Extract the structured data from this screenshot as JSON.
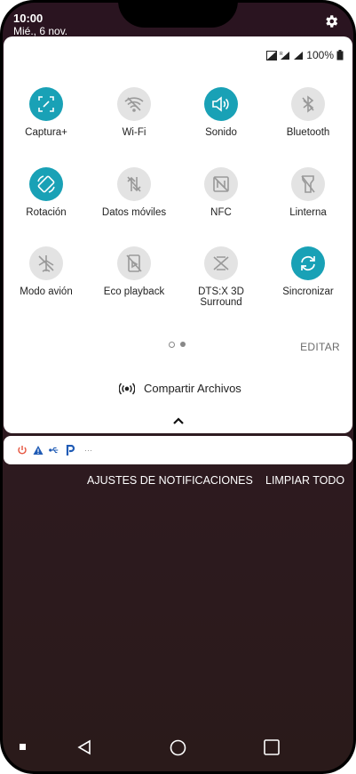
{
  "status": {
    "time": "10:00",
    "date": "Mié., 6 nov.",
    "battery": "100%"
  },
  "tiles": [
    {
      "label": "Captura+",
      "icon": "screenshot-edit-icon",
      "active": true
    },
    {
      "label": "Wi-Fi",
      "icon": "wifi-off-icon",
      "active": false
    },
    {
      "label": "Sonido",
      "icon": "speaker-icon",
      "active": true
    },
    {
      "label": "Bluetooth",
      "icon": "bluetooth-off-icon",
      "active": false
    },
    {
      "label": "Rotación",
      "icon": "rotation-icon",
      "active": true
    },
    {
      "label": "Datos móviles",
      "icon": "mobile-data-off-icon",
      "active": false
    },
    {
      "label": "NFC",
      "icon": "nfc-off-icon",
      "active": false
    },
    {
      "label": "Linterna",
      "icon": "flashlight-off-icon",
      "active": false
    },
    {
      "label": "Modo avión",
      "icon": "airplane-off-icon",
      "active": false
    },
    {
      "label": "Eco playback",
      "icon": "eco-playback-off-icon",
      "active": false
    },
    {
      "label": "DTS:X 3D Surround",
      "icon": "dts-off-icon",
      "active": false
    },
    {
      "label": "Sincronizar",
      "icon": "sync-icon",
      "active": true
    }
  ],
  "panel": {
    "edit_label": "EDITAR",
    "share_label": "Compartir Archivos"
  },
  "notifications": {
    "settings_label": "AJUSTES DE NOTIFICACIONES",
    "clear_label": "LIMPIAR TODO",
    "more": "···"
  },
  "colors": {
    "accent": "#19a1b6",
    "inactive": "#e3e3e3"
  }
}
